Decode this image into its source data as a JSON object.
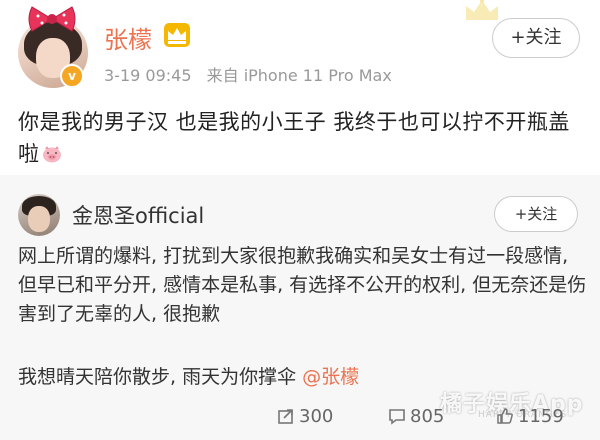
{
  "post": {
    "username": "张檬",
    "date": "3-19 09:45",
    "source": "来自 iPhone 11 Pro Max",
    "follow_label": "+关注",
    "text": "你是我的男子汉  也是我的小王子  我终于也可以拧不开瓶盖啦"
  },
  "repost": {
    "username": "金恩圣official",
    "follow_label": "+关注",
    "text": "网上所谓的爆料, 打扰到大家很抱歉我确实和吴女士有过一段感情, 但早已和平分开, 感情本是私事, 有选择不公开的权利, 但无奈还是伤害到了无辜的人, 很抱歉",
    "text2": "我想晴天陪你散步,  雨天为你撑伞 ",
    "mention": "@张檬"
  },
  "stats": {
    "reposts": "300",
    "comments": "805",
    "likes": "1159"
  },
  "watermark": {
    "text": "橘子娱乐App",
    "sub": "HAPPY ORANGES"
  },
  "colors": {
    "accent": "#eb7350",
    "verified": "#f5a623",
    "repost_bg": "#f7f7f7"
  }
}
